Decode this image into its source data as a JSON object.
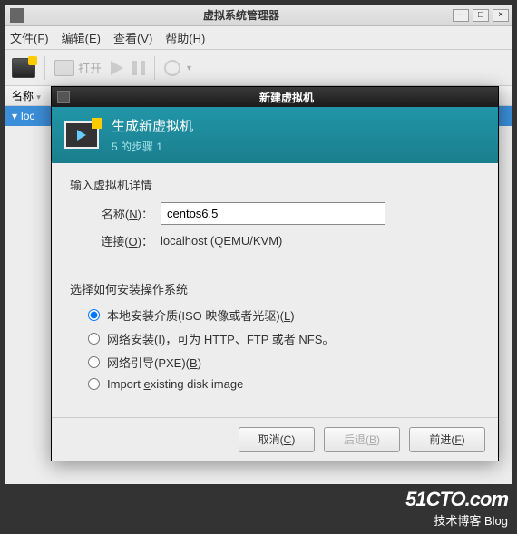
{
  "main_window": {
    "title": "虚拟系统管理器",
    "menus": {
      "file": "文件(F)",
      "edit": "编辑(E)",
      "view": "查看(V)",
      "help": "帮助(H)"
    },
    "toolbar": {
      "open": "打开"
    },
    "table": {
      "col_name": "名称",
      "row0": "loc"
    }
  },
  "dialog": {
    "title": "新建虚拟机",
    "header_title": "生成新虚拟机",
    "header_step": "5 的步骤 1",
    "details_label": "输入虚拟机详情",
    "name_label": "名称(N)：",
    "name_value": "centos6.5",
    "conn_label": "连接(O)：",
    "conn_value": "localhost (QEMU/KVM)",
    "install_label": "选择如何安装操作系统",
    "radios": {
      "local": "本地安装介质(ISO 映像或者光驱)(L)",
      "network": "网络安装(I)，可为 HTTP、FTP 或者 NFS。",
      "pxe": "网络引导(PXE)(B)",
      "import": "Import existing disk image"
    },
    "selected_radio": "local",
    "buttons": {
      "cancel": "取消(C)",
      "back": "后退(B)",
      "forward": "前进(F)"
    }
  },
  "watermark": {
    "big": "51CTO.com",
    "sub": "技术博客  Blog"
  }
}
